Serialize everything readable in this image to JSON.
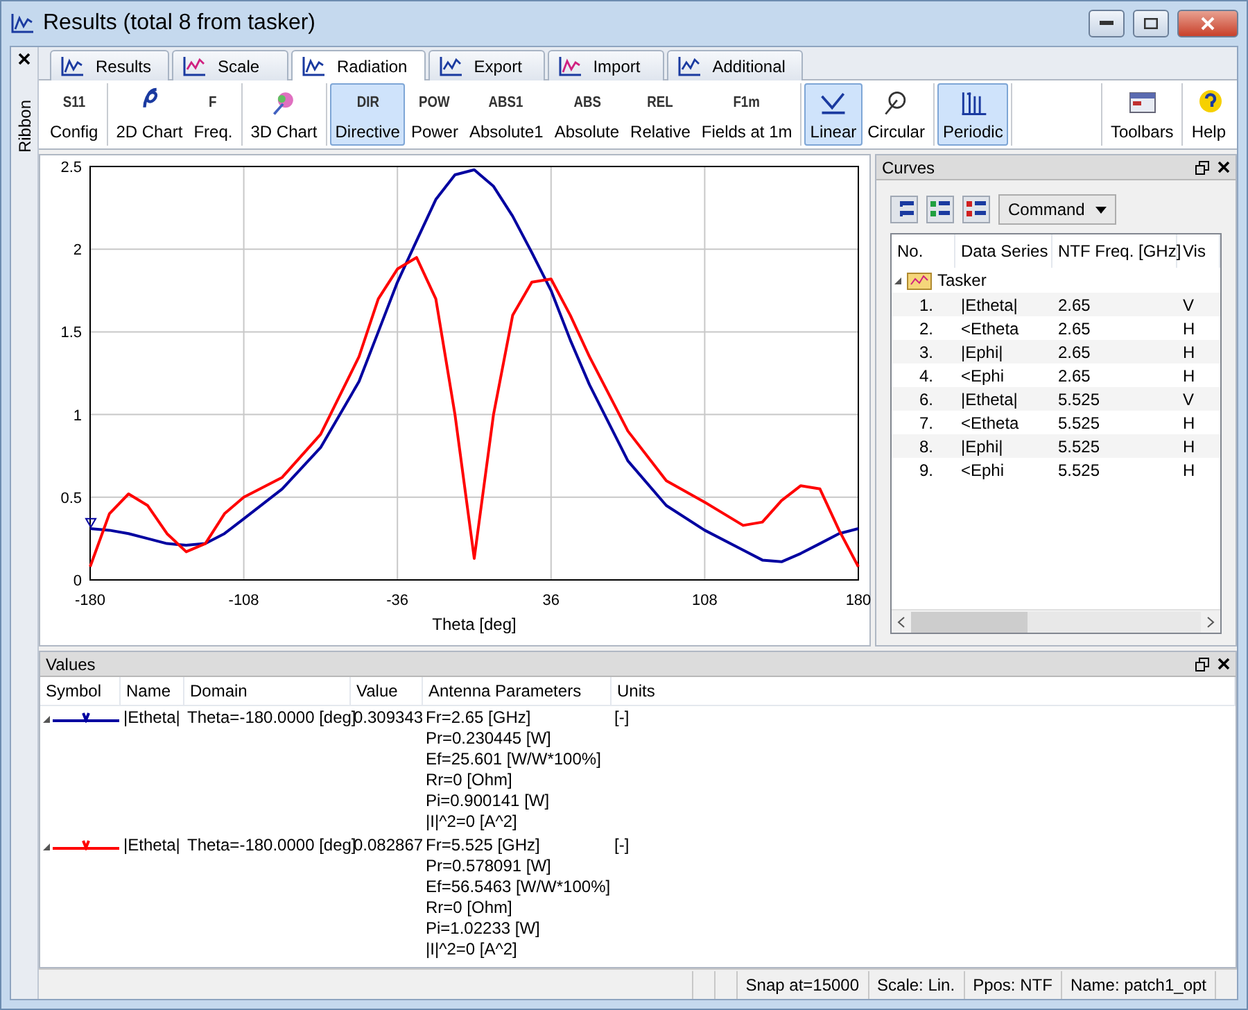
{
  "window": {
    "title": "Results (total 8 from tasker)"
  },
  "ribbon_label": "Ribbon",
  "tabs": [
    {
      "label": "Results",
      "selected": false
    },
    {
      "label": "Scale",
      "selected": false
    },
    {
      "label": "Radiation",
      "selected": true
    },
    {
      "label": "Export",
      "selected": false
    },
    {
      "label": "Import",
      "selected": false
    },
    {
      "label": "Additional",
      "selected": false
    }
  ],
  "ribbon_groups": [
    [
      {
        "label": "Config",
        "icon_text": "S11",
        "selected": false
      }
    ],
    [
      {
        "label": "2D Chart",
        "selected": false
      },
      {
        "label": "Freq.",
        "icon_text": "F",
        "selected": false
      }
    ],
    [
      {
        "label": "3D Chart",
        "selected": false
      }
    ],
    [
      {
        "label": "Directive",
        "icon_text": "DIR",
        "selected": true
      },
      {
        "label": "Power",
        "icon_text": "POW",
        "selected": false
      },
      {
        "label": "Absolute1",
        "icon_text": "ABS1",
        "selected": false
      },
      {
        "label": "Absolute",
        "icon_text": "ABS",
        "selected": false
      },
      {
        "label": "Relative",
        "icon_text": "REL",
        "selected": false
      },
      {
        "label": "Fields at 1m",
        "icon_text": "F1m",
        "selected": false
      }
    ],
    [
      {
        "label": "Linear",
        "selected": true
      },
      {
        "label": "Circular",
        "selected": false
      }
    ],
    [
      {
        "label": "Periodic",
        "selected": true
      }
    ]
  ],
  "ribbon_right": [
    {
      "label": "Toolbars"
    },
    {
      "label": "Help"
    }
  ],
  "chart": {
    "chart_data": {
      "type": "line",
      "grid": true,
      "xlabel": "Theta [deg]",
      "xlim": [
        -180,
        180
      ],
      "ylim": [
        0,
        2.5
      ],
      "xticks": [
        -180,
        -108,
        -36,
        36,
        108,
        180
      ],
      "yticks": [
        0,
        0.5,
        1,
        1.5,
        2,
        2.5
      ],
      "x": [
        -180,
        -171,
        -162,
        -153,
        -144,
        -135,
        -126,
        -117,
        -108,
        -90,
        -72,
        -54,
        -45,
        -36,
        -27,
        -18,
        -9,
        0,
        9,
        18,
        27,
        36,
        45,
        54,
        72,
        90,
        108,
        126,
        135,
        144,
        153,
        162,
        171,
        180
      ],
      "series": [
        {
          "color": "#0000a0",
          "values": [
            0.31,
            0.3,
            0.28,
            0.25,
            0.22,
            0.21,
            0.22,
            0.28,
            0.37,
            0.55,
            0.8,
            1.2,
            1.5,
            1.8,
            2.05,
            2.3,
            2.45,
            2.48,
            2.38,
            2.2,
            1.98,
            1.75,
            1.45,
            1.18,
            0.72,
            0.45,
            0.3,
            0.18,
            0.12,
            0.11,
            0.16,
            0.22,
            0.28,
            0.31
          ]
        },
        {
          "color": "#ff0000",
          "values": [
            0.08,
            0.4,
            0.52,
            0.45,
            0.28,
            0.17,
            0.22,
            0.4,
            0.5,
            0.62,
            0.88,
            1.35,
            1.7,
            1.88,
            1.95,
            1.7,
            1.0,
            0.13,
            1.0,
            1.6,
            1.8,
            1.82,
            1.6,
            1.35,
            0.9,
            0.6,
            0.47,
            0.33,
            0.35,
            0.48,
            0.57,
            0.55,
            0.3,
            0.08
          ]
        }
      ]
    }
  },
  "curves": {
    "title": "Curves",
    "command": "Command",
    "columns": [
      "No.",
      "Data Series",
      "NTF Freq. [GHz]",
      "Vis"
    ],
    "group": {
      "label": "Tasker",
      "expanded": true,
      "children": [
        {
          "no": "1.",
          "series": "|Etheta|",
          "freq": "2.65",
          "vis": "V"
        },
        {
          "no": "2.",
          "series": "<Etheta",
          "freq": "2.65",
          "vis": "H"
        },
        {
          "no": "3.",
          "series": "|Ephi|",
          "freq": "2.65",
          "vis": "H"
        },
        {
          "no": "4.",
          "series": "<Ephi",
          "freq": "2.65",
          "vis": "H"
        },
        {
          "no": "6.",
          "series": "|Etheta|",
          "freq": "5.525",
          "vis": "V"
        },
        {
          "no": "7.",
          "series": "<Etheta",
          "freq": "5.525",
          "vis": "H"
        },
        {
          "no": "8.",
          "series": "|Ephi|",
          "freq": "5.525",
          "vis": "H"
        },
        {
          "no": "9.",
          "series": "<Ephi",
          "freq": "5.525",
          "vis": "H"
        }
      ]
    }
  },
  "values": {
    "title": "Values",
    "columns": [
      "Symbol",
      "Name",
      "Domain",
      "Value",
      "Antenna Parameters",
      "Units"
    ],
    "rows": [
      {
        "color": "#0000a0",
        "expanded": true,
        "name": "|Etheta|",
        "domain": "Theta=-180.0000 [deg]",
        "value": "0.309343",
        "params": [
          "Fr=2.65 [GHz]",
          "Pr=0.230445 [W]",
          "Ef=25.601 [W/W*100%]",
          "Rr=0 [Ohm]",
          "Pi=0.900141 [W]",
          "|I|^2=0 [A^2]"
        ],
        "units": "[-]"
      },
      {
        "color": "#ff0000",
        "expanded": true,
        "name": "|Etheta|",
        "domain": "Theta=-180.0000 [deg]",
        "value": "0.082867",
        "params": [
          "Fr=5.525 [GHz]",
          "Pr=0.578091 [W]",
          "Ef=56.5463 [W/W*100%]",
          "Rr=0 [Ohm]",
          "Pi=1.02233 [W]",
          "|I|^2=0 [A^2]"
        ],
        "units": "[-]"
      }
    ]
  },
  "status_bar": [
    "Snap at=15000",
    "Scale: Lin.",
    "Ppos: NTF",
    "Name: patch1_opt"
  ]
}
